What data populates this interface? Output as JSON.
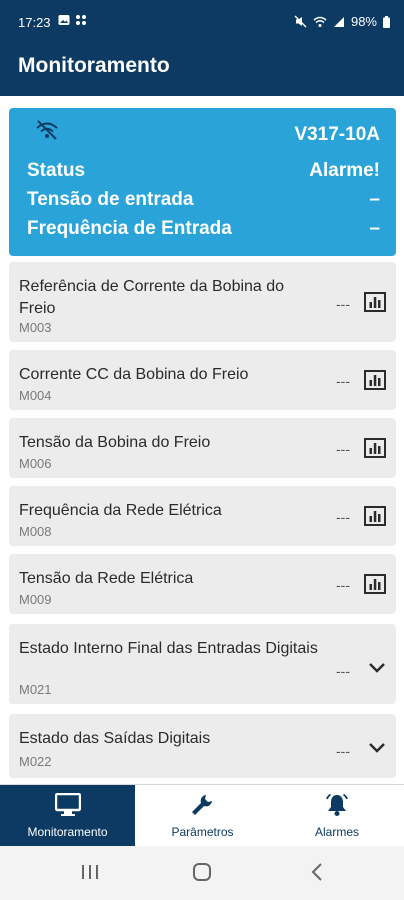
{
  "status_bar": {
    "time": "17:23",
    "battery": "98%"
  },
  "app_bar": {
    "title": "Monitoramento"
  },
  "device": {
    "model": "V317-10A",
    "rows": [
      {
        "label": "Status",
        "value": "Alarme!"
      },
      {
        "label": "Tensão de entrada",
        "value": "–"
      },
      {
        "label": "Frequência de Entrada",
        "value": "–"
      }
    ]
  },
  "items": [
    {
      "name": "Referência de Corrente da Bobina do Freio",
      "code": "M003",
      "value": "---",
      "icon": "chart-icon"
    },
    {
      "name": "Corrente CC da Bobina do Freio",
      "code": "M004",
      "value": "---",
      "icon": "chart-icon"
    },
    {
      "name": "Tensão da Bobina do Freio",
      "code": "M006",
      "value": "---",
      "icon": "chart-icon"
    },
    {
      "name": "Frequência da Rede Elétrica",
      "code": "M008",
      "value": "---",
      "icon": "chart-icon"
    },
    {
      "name": "Tensão da Rede Elétrica",
      "code": "M009",
      "value": "---",
      "icon": "chart-icon"
    },
    {
      "name": "Estado Interno Final das Entradas Digitais",
      "code": "M021",
      "value": "---",
      "icon": "chevron-down-icon"
    },
    {
      "name": "Estado das Saídas Digitais",
      "code": "M022",
      "value": "---",
      "icon": "chevron-down-icon"
    }
  ],
  "nav": [
    {
      "label": "Monitoramento",
      "icon": "monitor-icon",
      "active": true
    },
    {
      "label": "Parâmetros",
      "icon": "wrench-icon",
      "active": false
    },
    {
      "label": "Alarmes",
      "icon": "bell-icon",
      "active": false
    }
  ],
  "colors": {
    "primary": "#0c3a63",
    "card": "#2aa4d8",
    "item_bg": "#ececec"
  }
}
